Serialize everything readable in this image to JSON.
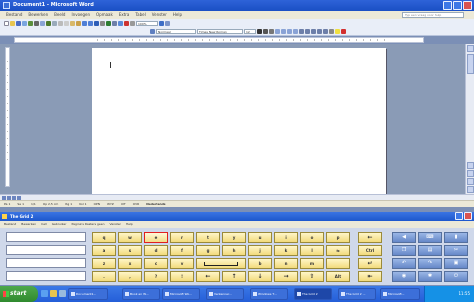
{
  "word": {
    "title": "Document1 - Microsoft Word",
    "menu": [
      "Bestand",
      "Bewerken",
      "Beeld",
      "Invoegen",
      "Opmaak",
      "Extra",
      "Tabel",
      "Venster",
      "Help"
    ],
    "help_placeholder": "Typ een vraag voor hulp",
    "style_box": "Normaal",
    "font_box": "Times New Roman",
    "size_box": "12",
    "zoom_box": "100%",
    "status": [
      "Pa 1",
      "Se 1",
      "1/1",
      "Op 2,5 cm",
      "Rg 1",
      "Kol 1",
      "OPN",
      "WYZ",
      "UIT",
      "OVR",
      "Nederlands"
    ]
  },
  "osk": {
    "title": "The Grid 2",
    "menu": [
      "Bestand",
      "Bewerken",
      "Cell",
      "Gebruiker",
      "Pagina's Rasters geen",
      "Venster",
      "Help"
    ],
    "rows": [
      [
        "q",
        "w",
        "e",
        "r",
        "t",
        "y",
        "u",
        "i",
        "o",
        "p",
        "←"
      ],
      [
        "a",
        "s",
        "d",
        "f",
        "g",
        "h",
        "j",
        "k",
        "l",
        "⇆",
        "Ctrl"
      ],
      [
        "z",
        "x",
        "c",
        "v",
        "",
        "",
        "b",
        "n",
        "m",
        "",
        "↵"
      ],
      [
        ".",
        ",",
        "?",
        "!",
        "←",
        "↑",
        "↓",
        "→",
        "⇧",
        "Alt",
        "⇤"
      ]
    ],
    "active_key": "e"
  },
  "taskbar": {
    "start_label": "start",
    "tasks": [
      "Document1...",
      "Book en W...",
      "Microsoft Wo...",
      "Verkenner...",
      "Windows T...",
      "The Grid 2",
      "The Grid 2 ...",
      "Microsoft..."
    ],
    "clock": "11:55"
  }
}
